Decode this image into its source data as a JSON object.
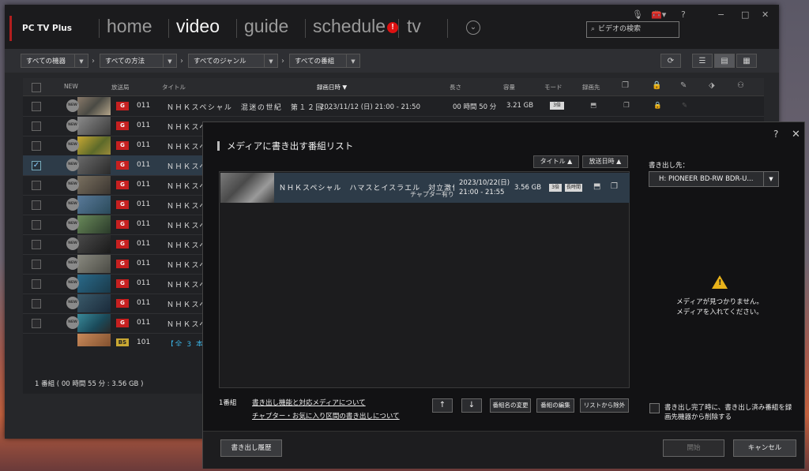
{
  "app": {
    "name": "PC TV Plus",
    "nav": [
      {
        "label": "home",
        "active": false
      },
      {
        "label": "video",
        "active": true
      },
      {
        "label": "guide",
        "active": false
      },
      {
        "label": "schedule",
        "active": false,
        "badge": "!"
      },
      {
        "label": "tv",
        "active": false
      }
    ],
    "window_controls": {
      "help": "?",
      "minimize": "−",
      "maximize": "□",
      "close": "✕"
    },
    "search_placeholder": "ビデオの検索"
  },
  "filters": [
    "すべての機器",
    "すべての方法",
    "すべてのジャンル",
    "すべての番組"
  ],
  "table": {
    "headers": {
      "new": "NEW",
      "channel": "放送局",
      "title": "タイトル",
      "date": "録画日時 ▼",
      "length": "長さ",
      "size": "容量",
      "mode": "モード",
      "dest": "録画先"
    },
    "rows": [
      {
        "channel": "011",
        "title": "ＮＨＫスペシャル　混迷の世紀　第１２回...",
        "date": "2023/11/12 (日) 21:00 - 21:50",
        "length": "00 時間 50 分",
        "size": "3.21 GB",
        "mode": "3倍",
        "checked": false
      },
      {
        "channel": "011",
        "title": "ＮＨＫスペシ",
        "checked": false
      },
      {
        "channel": "011",
        "title": "ＮＨＫスペシ",
        "checked": false
      },
      {
        "channel": "011",
        "title": "ＮＨＫスペシ",
        "checked": true
      },
      {
        "channel": "011",
        "title": "ＮＨＫスペシ",
        "checked": false
      },
      {
        "channel": "011",
        "title": "ＮＨＫスペシ",
        "checked": false
      },
      {
        "channel": "011",
        "title": "ＮＨＫスペシ",
        "checked": false
      },
      {
        "channel": "011",
        "title": "ＮＨＫスペシ",
        "checked": false
      },
      {
        "channel": "011",
        "title": "ＮＨＫスペシ",
        "checked": false
      },
      {
        "channel": "011",
        "title": "ＮＨＫスペシ",
        "checked": false
      },
      {
        "channel": "011",
        "title": "ＮＨＫスペシ",
        "checked": false
      },
      {
        "channel": "011",
        "title": "ＮＨＫスペシ",
        "checked": false
      }
    ],
    "partial_row": {
      "channel": "101",
      "title": "【全 3 本】"
    },
    "status": "1 番組 ( 00 時間 55 分 : 3.56 GB )"
  },
  "dialog": {
    "title": "メディアに書き出す番組リスト",
    "help": "?",
    "close": "✕",
    "sort_title": "タイトル ▲",
    "sort_date": "放送日時 ▲",
    "item": {
      "title": "ＮＨＫスペシャル　ハマスとイスラエル　対立激化ど...",
      "sub": "チャプター有り",
      "date_line1": "2023/10/22(日)",
      "date_line2": "21:00 - 21:55",
      "size": "3.56 GB",
      "mode": "3倍",
      "flag": "長時間"
    },
    "dest_label": "書き出し先：",
    "dest_value": "H:  PIONEER  BD-RW    BDR-U...",
    "message_line1": "メディアが見つかりません。",
    "message_line2": "メディアを入れてください。",
    "count": "1番組",
    "link1": "書き出し機能と対応メディアについて",
    "link2": "チャプター・お気に入り区間の書き出しについて",
    "btn_up": "↑",
    "btn_down": "↓",
    "btn_rename": "番組名の変更",
    "btn_edit": "番組の編集",
    "btn_remove": "リストから除外",
    "delete_option": "書き出し完了時に、書き出し済み番組を録画先機器から削除する",
    "history_button": "書き出し履歴",
    "start_button": "開始",
    "cancel_button": "キャンセル"
  },
  "colors": {
    "channel_badge": "#c62020",
    "selected_row": "#2d3b48",
    "warning": "#e8b21a",
    "brand_accent": "#b21e1e"
  }
}
